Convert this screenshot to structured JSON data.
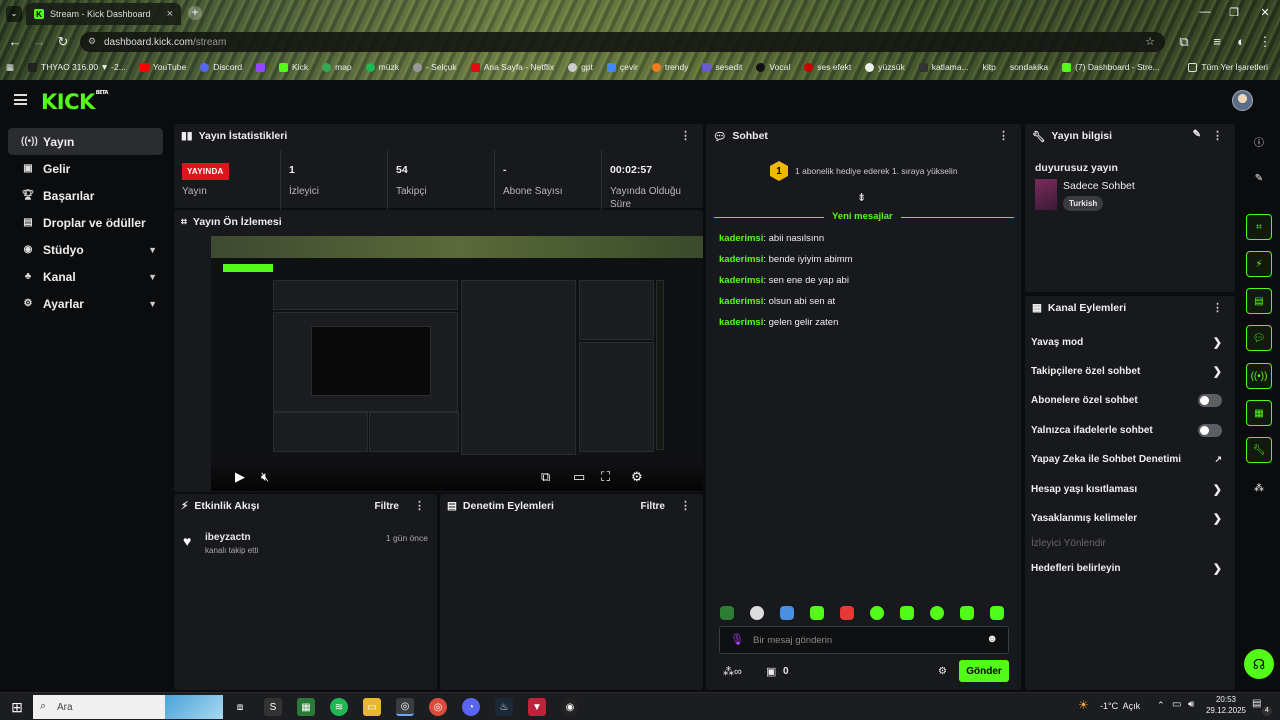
{
  "browser": {
    "tab_title": "Stream - Kick Dashboard",
    "url_host": "dashboard.kick.com",
    "url_path": "/stream",
    "bookmarks": [
      "THYAO 316.00 ▼ -2...",
      "YouTube",
      "Discord",
      "",
      "Kick",
      "map",
      "müzk",
      "- Selçuk",
      "Ana Sayfa - Netflix",
      "gpt",
      "çevir",
      "trendy",
      "sesedit",
      "Vocal",
      "ses efekt",
      "yüzsük",
      "katlama...",
      "kitp",
      "sondakika",
      "(7) Dashboard - Stre...",
      "Tüm Yer İşaretleri"
    ]
  },
  "nav": {
    "brand": "KICK",
    "brand_badge": "BETA"
  },
  "sidebar": {
    "items": [
      {
        "label": "Yayın",
        "icon": "broadcast-icon"
      },
      {
        "label": "Gelir",
        "icon": "revenue-icon"
      },
      {
        "label": "Başarılar",
        "icon": "trophy-icon"
      },
      {
        "label": "Droplar ve ödüller",
        "icon": "gift-icon"
      },
      {
        "label": "Stüdyo",
        "icon": "studio-icon"
      },
      {
        "label": "Kanal",
        "icon": "channel-icon"
      },
      {
        "label": "Ayarlar",
        "icon": "gear-icon"
      }
    ]
  },
  "stats": {
    "title": "Yayın İstatistikleri",
    "live_badge": "YAYINDA",
    "items": [
      {
        "value": "",
        "label": "Yayın"
      },
      {
        "value": "1",
        "label": "İzleyici"
      },
      {
        "value": "54",
        "label": "Takipçi"
      },
      {
        "value": "-",
        "label": "Abone Sayısı"
      },
      {
        "value": "00:02:57",
        "label": "Yayında Olduğu Süre"
      }
    ]
  },
  "preview": {
    "title": "Yayın Ön İzlemesi"
  },
  "activity": {
    "title": "Etkinlik Akışı",
    "filter": "Filtre",
    "events": [
      {
        "user": "ibeyzactn",
        "desc": "kanalı takip etti",
        "time": "1 gün önce"
      }
    ]
  },
  "moderation": {
    "title": "Denetim Eylemleri",
    "filter": "Filtre"
  },
  "chat": {
    "title": "Sohbet",
    "gift_banner": "1 abonelik hediye ederek 1. sıraya yükselin",
    "gift_rank": "1",
    "new_messages": "Yeni mesajlar",
    "messages": [
      {
        "user": "kaderimsi",
        "text": ": abii nasılsınn"
      },
      {
        "user": "kaderimsi",
        "text": ": bende iyiyim abimm"
      },
      {
        "user": "kaderimsi",
        "text": ": sen ene de yap abi"
      },
      {
        "user": "kaderimsi",
        "text": ": olsun abi sen at"
      },
      {
        "user": "kaderimsi",
        "text": ": gelen gelir zaten"
      }
    ],
    "placeholder": "Bir mesaj gönderin",
    "points": "0",
    "send": "Gönder"
  },
  "stream_info": {
    "title": "Yayın bilgisi",
    "stream_title": "duyurusuz yayın",
    "category": "Sadece Sohbet",
    "tag": "Turkish"
  },
  "channel_actions": {
    "title": "Kanal Eylemleri",
    "items": [
      {
        "label": "Yavaş mod",
        "control": "chevron"
      },
      {
        "label": "Takipçilere özel sohbet",
        "control": "chevron"
      },
      {
        "label": "Abonelere özel sohbet",
        "control": "toggle"
      },
      {
        "label": "Yalnızca ifadelerle sohbet",
        "control": "toggle"
      },
      {
        "label": "Yapay Zeka ile Sohbet Denetimi",
        "control": "external"
      },
      {
        "label": "Hesap yaşı kısıtlaması",
        "control": "chevron"
      },
      {
        "label": "Yasaklanmış kelimeler",
        "control": "chevron"
      },
      {
        "label": "İzleyici Yönlendir",
        "control": "none"
      },
      {
        "label": "Hedefleri belirleyin",
        "control": "chevron"
      }
    ]
  },
  "taskbar": {
    "search": "Ara",
    "weather": "-1°C  Açık",
    "time": "20:53",
    "date": "29.12.2025",
    "notif": "4"
  },
  "colors": {
    "accent": "#53fc18",
    "live": "#e0151b",
    "panel": "#18191c"
  }
}
